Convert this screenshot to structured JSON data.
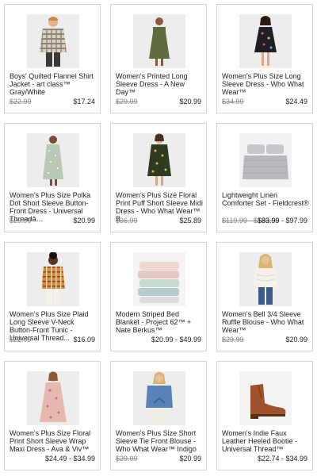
{
  "products": [
    {
      "title": "Boys' Quilted Flannel Shirt Jacket - art class™ Gray/White",
      "old_price": "$22.99",
      "price": "$17.24",
      "icon": "flannel-jacket"
    },
    {
      "title": "Women's Printed Long Sleeve Dress - A New Day™",
      "old_price": "$29.99",
      "price": "$20.99",
      "icon": "olive-dress"
    },
    {
      "title": "Women's Plus Size Long Sleeve Dress - Who What Wear™",
      "old_price": "$34.99",
      "price": "$24.49",
      "icon": "floral-dress"
    },
    {
      "title": "Women's Plus Size Polka Dot Short Sleeve Button-Front Dress - Universal Threadâ…",
      "old_price": "$29.99",
      "price": "$20.99",
      "icon": "polka-dress"
    },
    {
      "title": "Women's Plus Size Floral Print Puff Short Sleeve Midi Dress - Who What Wear™ B...",
      "old_price": "$36.99",
      "price": "$25.89",
      "icon": "midi-dress"
    },
    {
      "title": "Lightweight Linen Comforter Set - Fieldcrest®",
      "old_price": "$119.99 - $139.99",
      "price": "$83.99 - $97.99",
      "icon": "comforter"
    },
    {
      "title": "Women's Plus Size Plaid Long Sleeve V-Neck Button-Front Tunic - Universal Thread...",
      "old_price": "$22.99",
      "price": "$16.09",
      "icon": "plaid-tunic"
    },
    {
      "title": "Modern Striped Bed Blanket - Project 62™ + Nate Berkus™",
      "old_price": "",
      "price": "$20.99 - $49.99",
      "icon": "blankets"
    },
    {
      "title": "Women's Bell 3/4 Sleeve Ruffle Blouse - Who What Wear™",
      "old_price": "$29.99",
      "price": "$20.99",
      "icon": "ruffle-blouse"
    },
    {
      "title": "Women's Plus Size Floral Print Short Sleeve Wrap Maxi Dress - Ava & Viv™",
      "old_price": "",
      "price": "$24.49 - $34.99",
      "icon": "maxi-dress"
    },
    {
      "title": "Women's Plus Size Short Sleeve Tie Front Blouse - Who What Wear™ Indigo",
      "old_price": "$29.99",
      "price": "$20.99",
      "icon": "denim-blouse"
    },
    {
      "title": "Women's Indie Faux Leather Heeled Bootie - Universal Thread™",
      "old_price": "",
      "price": "$22.74 - $34.99",
      "icon": "bootie"
    }
  ]
}
